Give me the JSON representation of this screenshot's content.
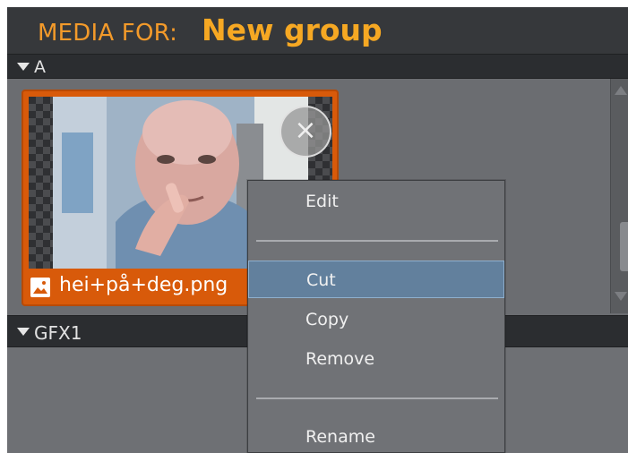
{
  "title": {
    "prefix": "MEDIA FOR:",
    "group_name": "New group"
  },
  "sections": [
    {
      "label": "A",
      "expanded": true
    },
    {
      "label": "GFX1",
      "expanded": true
    }
  ],
  "media_items": [
    {
      "filename": "hei+på+deg.png",
      "selected": true,
      "icon": "image-icon"
    }
  ],
  "context_menu": {
    "items": [
      {
        "label": "Edit",
        "selected": false
      },
      {
        "label": "Cut",
        "selected": true
      },
      {
        "label": "Copy",
        "selected": false
      },
      {
        "label": "Remove",
        "selected": false
      },
      {
        "label": "Rename",
        "selected": false
      }
    ]
  },
  "colors": {
    "accent": "#f39a2a",
    "tile_highlight": "#d85a0a",
    "menu_selection": "#62809d"
  }
}
